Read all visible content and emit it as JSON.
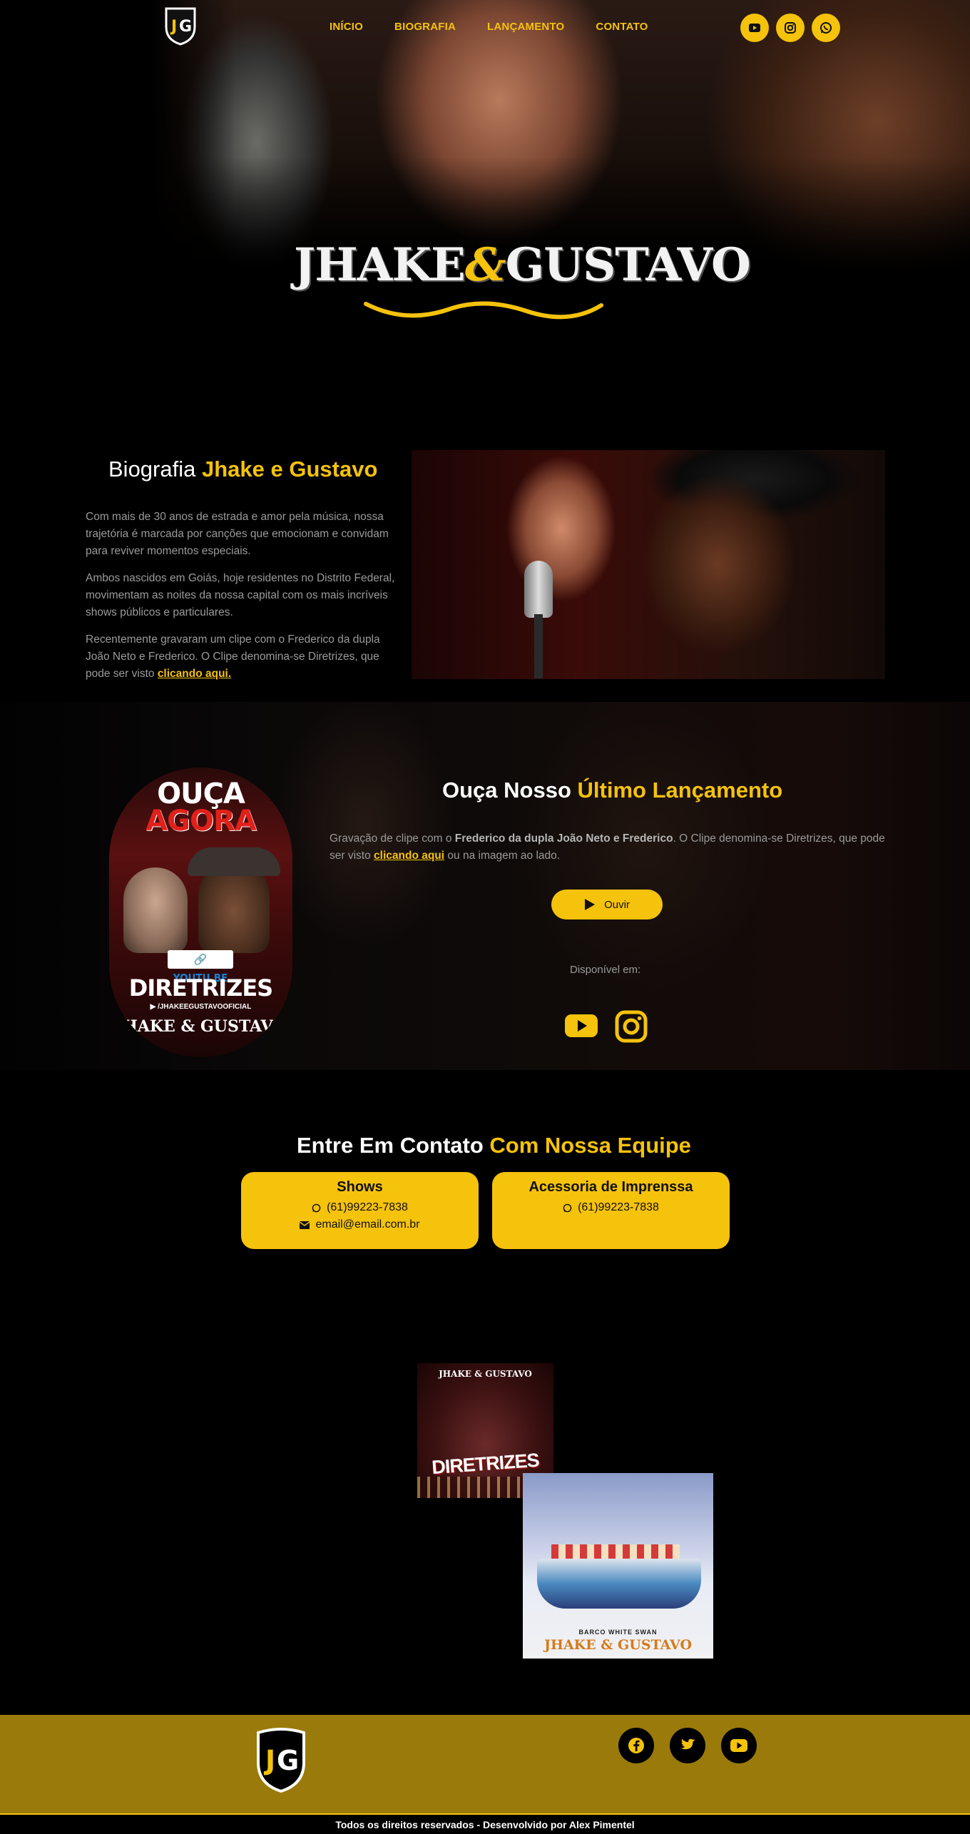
{
  "nav": {
    "items": [
      "INÍCIO",
      "BIOGRAFIA",
      "LANÇAMENTO",
      "CONTATO"
    ],
    "social_icons": [
      "youtube-icon",
      "instagram-icon",
      "whatsapp-icon"
    ]
  },
  "hero": {
    "brand_left": "JHAKE",
    "brand_amp": "&",
    "brand_right": "GUSTAVO"
  },
  "bio": {
    "title_plain": "Biografia",
    "title_highlight": "Jhake e Gustavo",
    "p1": "Com mais de 30 anos de estrada e amor pela música, nossa trajetória é marcada por canções que emocionam e convidam para reviver momentos especiais.",
    "p2": "Ambos nascidos em Goiás, hoje residentes no Distrito Federal, movimentam as noites da nossa capital com os mais incríveis shows públicos e particulares.",
    "p3": "Recentemente gravaram um clipe com o Frederico da dupla João Neto e Frederico. O Clipe denomina-se Diretrizes, que pode ser visto",
    "p3_link": "clicando aqui."
  },
  "launch": {
    "poster_line1": "OUÇA",
    "poster_line2": "AGORA",
    "poster_badge": "🔗 YOUTU.BE",
    "poster_song": "DIRETRIZES",
    "poster_handle": "▶ /JHAKEEGUSTAVOOFICIAL",
    "poster_brand": "JHAKE & GUSTAVO",
    "title_plain": "Ouça Nosso",
    "title_highlight": "Último Lançamento",
    "text_a": "Gravação de clipe com o",
    "text_bold": "Frederico da dupla João Neto e Frederico",
    "text_b": ". O Clipe denomina-se Diretrizes, que pode ser visto",
    "text_link": "clicando aqui",
    "text_c": "ou na imagem ao lado.",
    "button_label": "Ouvir",
    "available_label": "Disponível em:"
  },
  "contact": {
    "title_plain": "Entre Em Contato",
    "title_highlight": "Com Nossa Equipe",
    "cards": [
      {
        "title": "Shows",
        "phone": "(61)99223-7838",
        "email": "email@email.com.br"
      },
      {
        "title": "Acessoria de Imprenssa",
        "phone": "(61)99223-7838"
      }
    ]
  },
  "albums": {
    "album1_top": "JHAKE & GUSTAVO",
    "album1_title": "DIRETRIZES",
    "album2_sub": "BARCO WHITE SWAN",
    "album2_brand": "JHAKE & GUSTAVO"
  },
  "footer": {
    "social_icons": [
      "facebook-icon",
      "twitter-icon",
      "youtube-icon"
    ],
    "copyright": "Todos os direitos reservados - Desenvolvido por Alex Pimentel"
  },
  "colors": {
    "accent": "#f5c20c",
    "footer_bg": "#9a7a0a",
    "text_muted": "#9a9a9a"
  }
}
